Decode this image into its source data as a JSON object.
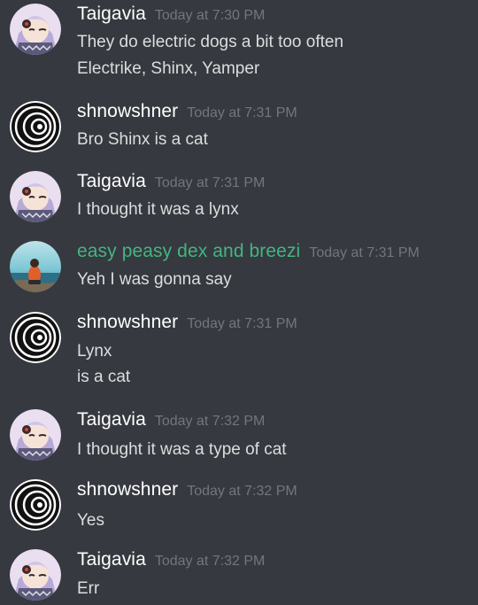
{
  "colors": {
    "background": "#36393f",
    "username_default": "#ffffff",
    "username_green": "#43b581",
    "timestamp": "#72767d",
    "message_text": "#dcddde"
  },
  "messages": [
    {
      "avatar": "anime-girl-avatar",
      "username": "Taigavia",
      "timestamp": "Today at 7:30 PM",
      "lines": [
        "They do electric dogs a bit too often",
        "Electrike, Shinx, Yamper"
      ]
    },
    {
      "avatar": "swirl-avatar",
      "username": "shnowshner",
      "timestamp": "Today at 7:31 PM",
      "lines": [
        "Bro Shinx is a cat"
      ]
    },
    {
      "avatar": "anime-girl-avatar",
      "username": "Taigavia",
      "timestamp": "Today at 7:31 PM",
      "lines": [
        "I thought it was a lynx"
      ]
    },
    {
      "avatar": "beach-avatar",
      "username": "easy peasy dex and breezi",
      "username_color": "green",
      "timestamp": "Today at 7:31 PM",
      "lines": [
        "Yeh I was gonna say"
      ]
    },
    {
      "avatar": "swirl-avatar",
      "username": "shnowshner",
      "timestamp": "Today at 7:31 PM",
      "lines": [
        "Lynx",
        "is a cat"
      ]
    },
    {
      "avatar": "anime-girl-avatar",
      "username": "Taigavia",
      "timestamp": "Today at 7:32 PM",
      "lines": [
        "I thought it was a type of cat"
      ]
    },
    {
      "avatar": "swirl-avatar",
      "username": "shnowshner",
      "timestamp": "Today at 7:32 PM",
      "lines": [
        "Yes"
      ]
    },
    {
      "avatar": "anime-girl-avatar",
      "username": "Taigavia",
      "timestamp": "Today at 7:32 PM",
      "lines": [
        "Err"
      ]
    }
  ]
}
